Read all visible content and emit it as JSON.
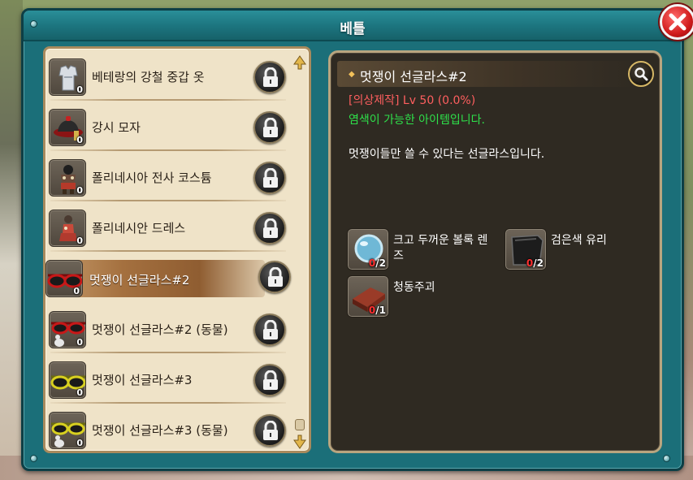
{
  "window": {
    "title": "베틀"
  },
  "list": {
    "items": [
      {
        "name": "베테랑의 강철 중갑 옷",
        "count": "0",
        "icon": "steel-armor-icon",
        "selected": false
      },
      {
        "name": "강시 모자",
        "count": "0",
        "icon": "jiangshi-hat-icon",
        "selected": false
      },
      {
        "name": "폴리네시아 전사 코스튬",
        "count": "0",
        "icon": "polynesian-warrior-costume-icon",
        "selected": false
      },
      {
        "name": "폴리네시안 드레스",
        "count": "0",
        "icon": "polynesian-dress-icon",
        "selected": false
      },
      {
        "name": "멋쟁이 선글라스#2",
        "count": "0",
        "icon": "red-sunglasses-icon",
        "selected": true
      },
      {
        "name": "멋쟁이 선글라스#2 (동물)",
        "count": "0",
        "icon": "red-sunglasses-animal-icon",
        "selected": false
      },
      {
        "name": "멋쟁이 선글라스#3",
        "count": "0",
        "icon": "yellow-sunglasses-icon",
        "selected": false
      },
      {
        "name": "멋쟁이 선글라스#3 (동물)",
        "count": "0",
        "icon": "yellow-sunglasses-animal-icon",
        "selected": false
      }
    ]
  },
  "detail": {
    "title": "멋쟁이 선글라스#2",
    "craft_type": "[의상제작] Lv 50 (0.0%)",
    "dye_note": "염색이 가능한 아이템입니다.",
    "description": "멋쟁이들만 쓸 수 있다는 선글라스입니다.",
    "materials": [
      {
        "name": "크고 두꺼운 볼록 렌즈",
        "have": "0",
        "need": "/2",
        "icon": "convex-lens-icon"
      },
      {
        "name": "검은색 유리",
        "have": "0",
        "need": "/2",
        "icon": "black-glass-icon"
      },
      {
        "name": "청동주괴",
        "have": "0",
        "need": "/1",
        "icon": "bronze-ingot-icon"
      }
    ]
  },
  "colors": {
    "frame": "#1b6f79",
    "list_bg": "#efe3c8",
    "detail_bg": "#2f2a22",
    "craft_type": "#ff5f5f",
    "dye_note": "#2ee04a",
    "selected": "#a4703f"
  }
}
